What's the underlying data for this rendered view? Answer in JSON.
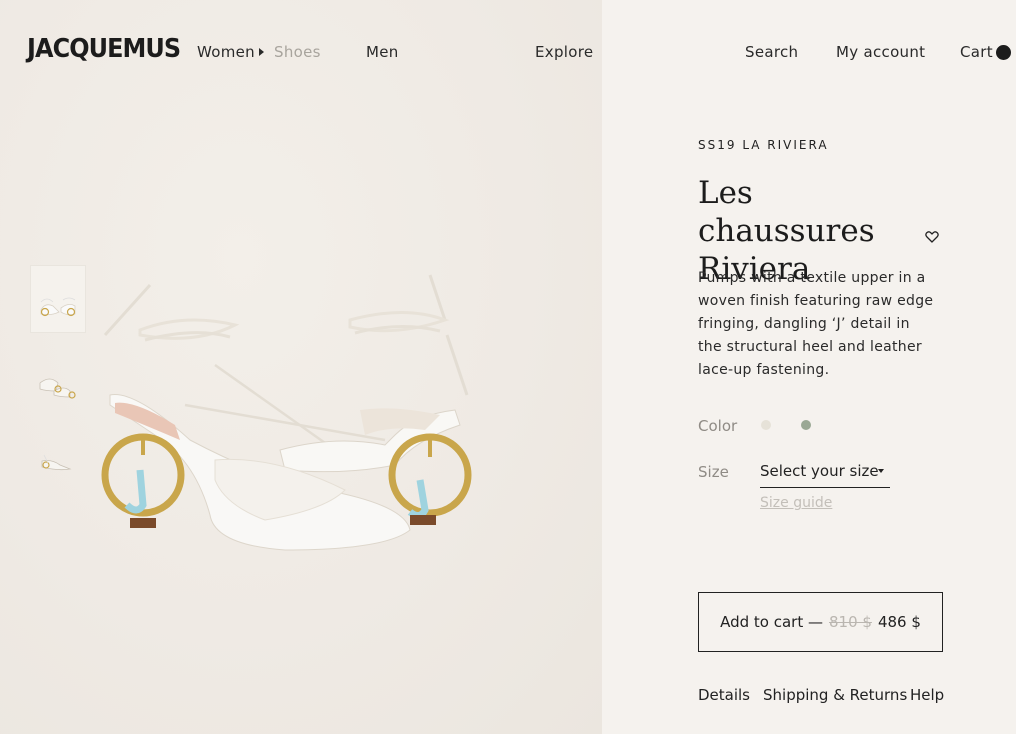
{
  "brand": {
    "logo": "JACQUEMUS"
  },
  "nav": {
    "women": "Women",
    "shoes": "Shoes",
    "men": "Men",
    "explore": "Explore",
    "search": "Search",
    "account": "My account",
    "cart": "Cart"
  },
  "product": {
    "collection": "SS19 LA RIVIERA",
    "title_line1": "Les chaussures",
    "title_line2": "Riviera",
    "description": "Pumps with a textile upper in a woven finish featuring raw edge fringing, dangling ‘J’ detail in the structural heel and leather lace-up fastening.",
    "color_label": "Color",
    "colors": [
      "#e6e2d8",
      "#9aa894"
    ],
    "size_label": "Size",
    "size_select": "Select your size",
    "size_guide": "Size guide",
    "add_to_cart": "Add to cart —",
    "old_price": "810 $",
    "price": "486 $"
  },
  "tabs": {
    "details": "Details",
    "shipping": "Shipping & Returns",
    "help": "Help"
  },
  "icons": {
    "heart": "heart-icon",
    "cart_indicator": "cart-dot-icon",
    "dropdown": "caret-down-icon"
  }
}
